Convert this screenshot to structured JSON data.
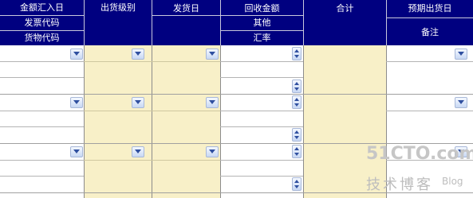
{
  "header": {
    "amount_date": "金额汇入日",
    "invoice_code": "发票代码",
    "goods_code": "货物代码",
    "shipping_level": "出货级别",
    "ship_date": "发货日",
    "recovered_amount": "回收金额",
    "other": "其他",
    "exchange_rate": "汇率",
    "total": "合计",
    "expected_ship_date": "预期出货日",
    "remarks": "备注"
  },
  "watermark": {
    "brand": "51CTO.com",
    "tagline": "技术博客",
    "blog": "Blog"
  },
  "colors": {
    "header_bg": "#000080",
    "cream": "#f8f0c8"
  }
}
